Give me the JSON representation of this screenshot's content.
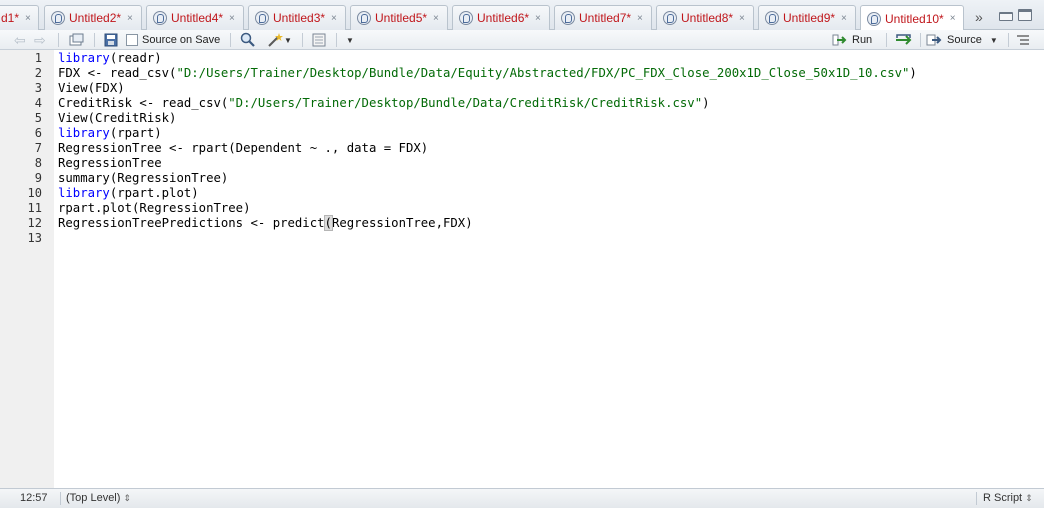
{
  "tabs": [
    {
      "label": "d1*",
      "active": false
    },
    {
      "label": "Untitled2*",
      "active": false
    },
    {
      "label": "Untitled4*",
      "active": false
    },
    {
      "label": "Untitled3*",
      "active": false
    },
    {
      "label": "Untitled5*",
      "active": false
    },
    {
      "label": "Untitled6*",
      "active": false
    },
    {
      "label": "Untitled7*",
      "active": false
    },
    {
      "label": "Untitled8*",
      "active": false
    },
    {
      "label": "Untitled9*",
      "active": false
    },
    {
      "label": "Untitled10*",
      "active": true
    }
  ],
  "tab_close_glyph": "×",
  "tab_overflow_glyph": "»",
  "toolbar": {
    "back_icon": "arrow-left-icon",
    "forward_icon": "arrow-right-icon",
    "source_on_save_label": "Source on Save",
    "source_on_save_checked": false,
    "run_label": "Run",
    "source_label": "Source"
  },
  "editor": {
    "line_numbers": [
      "1",
      "2",
      "3",
      "4",
      "5",
      "6",
      "7",
      "8",
      "9",
      "10",
      "11",
      "12",
      "13"
    ],
    "lines": [
      [
        {
          "t": "library",
          "c": "kw"
        },
        {
          "t": "(readr)",
          "c": ""
        }
      ],
      [
        {
          "t": "FDX <- read_csv(",
          "c": ""
        },
        {
          "t": "\"D:/Users/Trainer/Desktop/Bundle/Data/Equity/Abstracted/FDX/PC_FDX_Close_200x1D_Close_50x1D_10.csv\"",
          "c": "str"
        },
        {
          "t": ")",
          "c": ""
        }
      ],
      [
        {
          "t": "View(FDX)",
          "c": ""
        }
      ],
      [
        {
          "t": "CreditRisk <- read_csv(",
          "c": ""
        },
        {
          "t": "\"D:/Users/Trainer/Desktop/Bundle/Data/CreditRisk/CreditRisk.csv\"",
          "c": "str"
        },
        {
          "t": ")",
          "c": ""
        }
      ],
      [
        {
          "t": "View(CreditRisk)",
          "c": ""
        }
      ],
      [
        {
          "t": "library",
          "c": "kw"
        },
        {
          "t": "(rpart)",
          "c": ""
        }
      ],
      [
        {
          "t": "RegressionTree <- rpart(Dependent ~ ., data = FDX)",
          "c": ""
        }
      ],
      [
        {
          "t": "RegressionTree",
          "c": ""
        }
      ],
      [
        {
          "t": "summary(RegressionTree)",
          "c": ""
        }
      ],
      [
        {
          "t": "library",
          "c": "kw"
        },
        {
          "t": "(rpart.plot)",
          "c": ""
        }
      ],
      [
        {
          "t": "rpart.plot(RegressionTree)",
          "c": ""
        }
      ],
      [
        {
          "t": "RegressionTreePredictions <- predict",
          "c": ""
        },
        {
          "t": "(",
          "c": "paren-hl"
        },
        {
          "t": "RegressionTree,FDX)",
          "c": ""
        }
      ],
      [
        {
          "t": "",
          "c": ""
        }
      ]
    ]
  },
  "statusbar": {
    "position": "12:57",
    "scope": "(Top Level)",
    "file_type": "R Script"
  }
}
